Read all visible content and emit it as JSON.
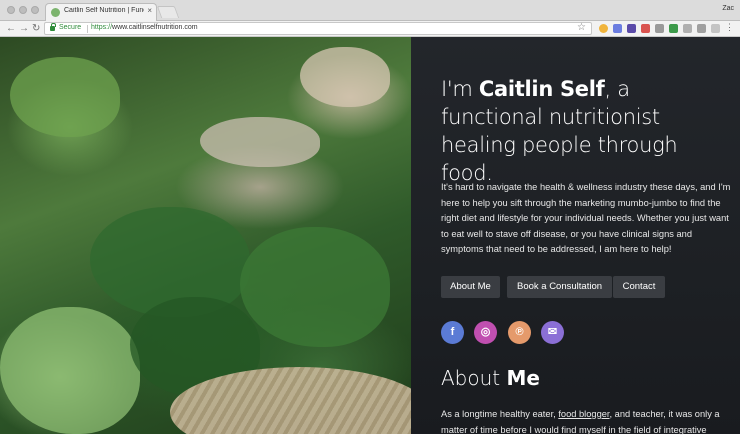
{
  "browser": {
    "tab_title": "Caitlin Self Nutrition | Functio",
    "tab_close": "×",
    "user_name": "Zac",
    "secure_label": "Secure",
    "url_scheme": "https://",
    "url_host": "www.caitlinselfnutrition.com",
    "back": "←",
    "forward": "→",
    "reload": "↻",
    "star": "☆",
    "menu": "⋮"
  },
  "hero": {
    "headline_pre": "I'm ",
    "headline_name": "Caitlin Self",
    "headline_post": ", a functional nutritionist healing people through food.",
    "intro": "It's hard to navigate the health & wellness industry these days, and I'm here to help you sift through the marketing mumbo-jumbo to find the right diet and lifestyle for your individual needs. Whether you just want to eat well to stave off disease, or you have clinical signs and symptoms that need to be addressed, I am here to help!",
    "buttons": [
      "About Me",
      "Book a Consultation",
      "Contact"
    ],
    "social": [
      {
        "icon": "facebook-icon",
        "glyph": "f",
        "color": "#5b7bd5"
      },
      {
        "icon": "instagram-icon",
        "glyph": "◎",
        "color": "#c04fb0"
      },
      {
        "icon": "pinterest-icon",
        "glyph": "℗",
        "color": "#e59a6b"
      },
      {
        "icon": "email-icon",
        "glyph": "✉",
        "color": "#8b6fd6"
      }
    ]
  },
  "about": {
    "title_pre": "About ",
    "title_bold": "Me",
    "text_pre": "As a longtime healthy eater, ",
    "text_link": "food blogger",
    "text_post": ", and teacher, it was only a matter of time before I would find myself in the field of integrative"
  }
}
